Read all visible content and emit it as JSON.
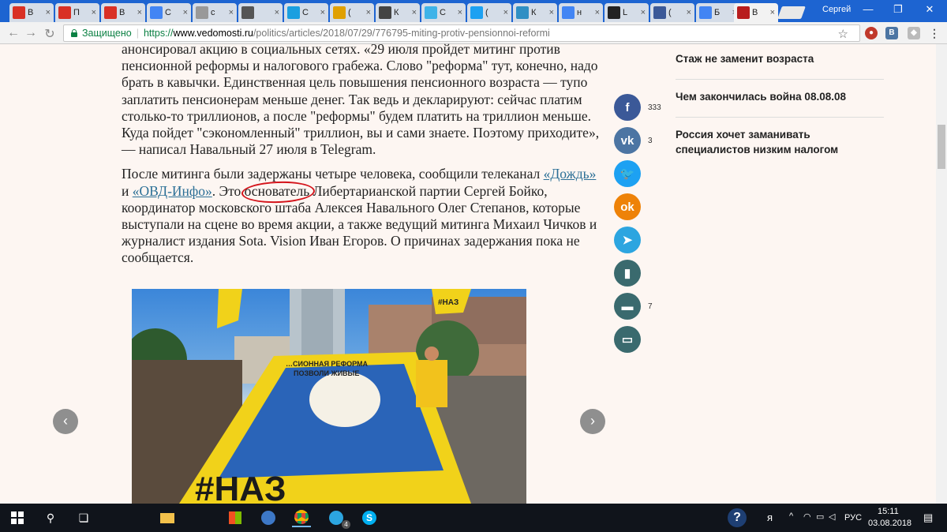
{
  "browser": {
    "tabs": [
      {
        "label": "В",
        "icon": "gmail-icon",
        "color": "#d93025"
      },
      {
        "label": "П",
        "icon": "gmail-icon",
        "color": "#d93025"
      },
      {
        "label": "В",
        "icon": "gmail-icon",
        "color": "#d93025"
      },
      {
        "label": "С",
        "icon": "docs-icon",
        "color": "#4285f4"
      },
      {
        "label": "с",
        "icon": "page-icon",
        "color": "#999999"
      },
      {
        "label": "",
        "icon": "ibru-icon",
        "color": "#555555"
      },
      {
        "label": "С",
        "icon": "n-icon",
        "color": "#1a9fe0"
      },
      {
        "label": "(",
        "icon": "globe-icon",
        "color": "#e0a000"
      },
      {
        "label": "К",
        "icon": "z-icon",
        "color": "#444444"
      },
      {
        "label": "С",
        "icon": "zen-icon",
        "color": "#3fb3e8"
      },
      {
        "label": "(",
        "icon": "twitter-icon",
        "color": "#1da1f2"
      },
      {
        "label": "К",
        "icon": "f-script-icon",
        "color": "#2f8fc4"
      },
      {
        "label": "н",
        "icon": "google-icon",
        "color": "#4285f4"
      },
      {
        "label": "L",
        "icon": "m-icon",
        "color": "#222222"
      },
      {
        "label": "(",
        "icon": "facebook-icon",
        "color": "#3b5998"
      },
      {
        "label": "Б",
        "icon": "google-icon",
        "color": "#4285f4"
      },
      {
        "label": "В",
        "icon": "vedomosti-icon",
        "color": "#b81d1d",
        "active": true
      }
    ],
    "profile": "Сергей",
    "address": {
      "secure_label": "Защищено",
      "url_proto": "https://",
      "url_host": "www.vedomosti.ru",
      "url_path": "/politics/articles/2018/07/29/776795-miting-protiv-pensionnoi-reformi"
    }
  },
  "article": {
    "para1": "анонсировал акцию в социальных сетях. «29 июля пройдет митинг против пенсионной реформы и налогового грабежа. Слово \"реформа\" тут, конечно, надо брать в кавычки. Единственная цель повышения пенсионного возраста — тупо заплатить пенсионерам меньше денег. Так ведь и декларируют: сейчас платим столько-то триллионов, а после \"реформы\" будем платить на триллион меньше. Куда пойдет \"сэкономленный\" триллион, вы и сами знаете. Поэтому приходите», — написал Навальный 27 июля в Telegram.",
    "para2_start": "После митинга были задержаны четыре человека, сообщили телеканал ",
    "link1": "«Дождь»",
    "and": " и ",
    "link2": "«ОВД-Инфо»",
    "para2_mid1": ". Это ",
    "circled_word": "основатель",
    "para2_end": " Либертарианской партии Сергей Бойко, координатор московского штаба Алексея Навального Олег Степанов, которые выступали на сцене во время акции, а также ведущий митинга Михаил Чичков и журналист издания Sota. Vision Иван Егоров. О причинах задержания пока не сообщается."
  },
  "photo": {
    "banner_text_1": "…СИОННАЯ РЕФОРМА",
    "banner_text_2": "ПОЗВОЛИ ЖИВЫЕ",
    "banner_bottom": "#НАЗ",
    "flag_text": "#НАЗ"
  },
  "share": [
    {
      "icon": "facebook-icon",
      "glyph": "f",
      "color": "#3b5998",
      "count": "333"
    },
    {
      "icon": "vk-icon",
      "glyph": "vk",
      "color": "#4c75a3",
      "count": "3"
    },
    {
      "icon": "twitter-icon",
      "glyph": "🐦",
      "color": "#1da1f2",
      "count": ""
    },
    {
      "icon": "odnoklassniki-icon",
      "glyph": "ok",
      "color": "#ee8208",
      "count": ""
    },
    {
      "icon": "telegram-icon",
      "glyph": "➤",
      "color": "#2ca5e0",
      "count": ""
    },
    {
      "icon": "bookmark-icon",
      "glyph": "▮",
      "color": "#3a6a6e",
      "count": ""
    },
    {
      "icon": "comment-icon",
      "glyph": "▬",
      "color": "#3a6a6e",
      "count": "7"
    },
    {
      "icon": "print-icon",
      "glyph": "▭",
      "color": "#3a6a6e",
      "count": ""
    }
  ],
  "sidebar": [
    {
      "title": "Стаж не заменит возраста"
    },
    {
      "title": "Чем закончилась война 08.08.08"
    },
    {
      "title": "Россия хочет заманивать специалистов низким налогом"
    }
  ],
  "taskbar": {
    "lang": "РУС",
    "ya": "я",
    "time": "15:11",
    "date": "03.08.2018",
    "telegram_badge": "4"
  }
}
